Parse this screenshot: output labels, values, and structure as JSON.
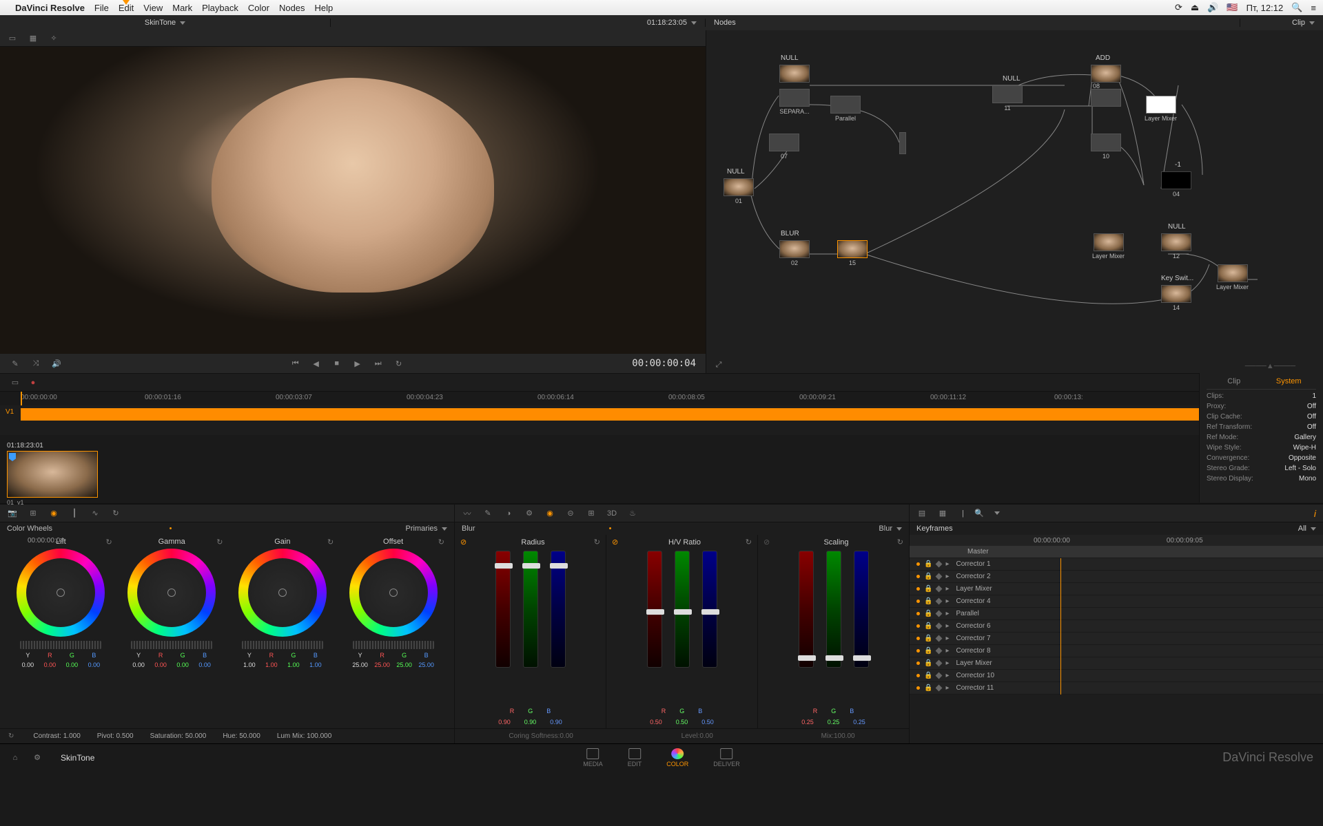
{
  "menubar": {
    "app": "DaVinci Resolve",
    "items": [
      "File",
      "Edit",
      "View",
      "Mark",
      "Playback",
      "Color",
      "Nodes",
      "Help"
    ],
    "clock": "Пт, 12:12"
  },
  "subbar": {
    "clip": "SkinTone",
    "time": "01:18:23:05",
    "panel1": "Nodes",
    "panel2": "Clip"
  },
  "viewer": {
    "timecode": "00:00:00:04"
  },
  "node_labels": {
    "null": "NULL",
    "add": "ADD",
    "blur": "BLUR",
    "parallel": "Parallel",
    "layer_mixer": "Layer Mixer",
    "key_switch": "Key Swit...",
    "separa": "SEPARA..."
  },
  "nodes_num": {
    "n01": "01",
    "n02": "02",
    "n07": "07",
    "n10": "10",
    "n11": "11",
    "n12": "12",
    "n14": "14",
    "n15": "15",
    "n04": "04",
    "n08": "08",
    "neg1": "-1"
  },
  "timeline": {
    "marks": [
      "00:00:00:00",
      "00:00:01:16",
      "00:00:03:07",
      "00:00:04:23",
      "00:00:06:14",
      "00:00:08:05",
      "00:00:09:21",
      "00:00:11:12",
      "00:00:13:"
    ],
    "track": "V1"
  },
  "clip": {
    "tc": "01:18:23:01",
    "id": "01",
    "vt": "v1"
  },
  "info": {
    "tabs": [
      "Clip",
      "System"
    ],
    "rows": [
      [
        "Clips:",
        "1"
      ],
      [
        "Proxy:",
        "Off"
      ],
      [
        "Clip Cache:",
        "Off"
      ],
      [
        "Ref Transform:",
        "Off"
      ],
      [
        "Ref Mode:",
        "Gallery"
      ],
      [
        "Wipe Style:",
        "Wipe-H"
      ],
      [
        "Convergence:",
        "Opposite"
      ],
      [
        "Stereo Grade:",
        "Left - Solo"
      ],
      [
        "Stereo Display:",
        "Mono"
      ]
    ]
  },
  "wheels": {
    "header": "Color Wheels",
    "mode": "Primaries",
    "names": [
      "Lift",
      "Gamma",
      "Gain",
      "Offset"
    ],
    "vals": [
      [
        "0.00",
        "0.00",
        "0.00",
        "0.00"
      ],
      [
        "0.00",
        "0.00",
        "0.00",
        "0.00"
      ],
      [
        "1.00",
        "1.00",
        "1.00",
        "1.00"
      ],
      [
        "25.00",
        "25.00",
        "25.00",
        "25.00"
      ]
    ]
  },
  "stats": {
    "contrast": "Contrast: 1.000",
    "pivot": "Pivot: 0.500",
    "sat": "Saturation: 50.000",
    "hue": "Hue: 50.000",
    "lum": "Lum Mix: 100.000"
  },
  "blur": {
    "header": "Blur",
    "panels": [
      {
        "name": "Radius",
        "vals": [
          "0.90",
          "0.90",
          "0.90"
        ],
        "pos": 10
      },
      {
        "name": "H/V Ratio",
        "vals": [
          "0.50",
          "0.50",
          "0.50"
        ],
        "pos": 50
      },
      {
        "name": "Scaling",
        "vals": [
          "0.25",
          "0.25",
          "0.25"
        ],
        "pos": 90
      }
    ],
    "stats": [
      "Coring Softness:0.00",
      "Level:0.00",
      "Mix:100.00"
    ],
    "right": "Blur"
  },
  "keyframes": {
    "header": "Keyframes",
    "all": "All",
    "tc": "00:00:00:04",
    "tcs": [
      "00:00:00:00",
      "00:00:09:05"
    ],
    "master": "Master",
    "items": [
      "Corrector 1",
      "Corrector 2",
      "Layer Mixer",
      "Corrector 4",
      "Parallel",
      "Corrector 6",
      "Corrector 7",
      "Corrector 8",
      "Layer Mixer",
      "Corrector 10",
      "Corrector 11"
    ]
  },
  "bottom": {
    "project": "SkinTone",
    "pages": [
      "MEDIA",
      "EDIT",
      "COLOR",
      "DELIVER"
    ],
    "brand": "DaVinci Resolve"
  }
}
